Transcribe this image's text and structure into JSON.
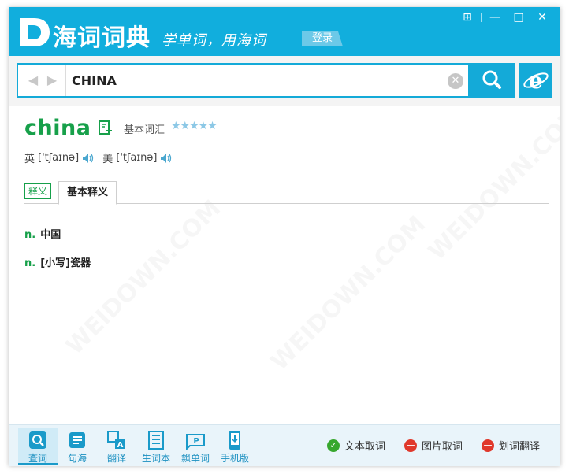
{
  "app": {
    "logo_text": "海词词典",
    "slogan": "学单词，用海词",
    "login_label": "登录"
  },
  "window_controls": {
    "menu": "⊞",
    "minimize": "—",
    "maximize": "□",
    "close": "✕"
  },
  "search": {
    "query": "CHINA"
  },
  "entry": {
    "headword": "china",
    "vocab_level": "基本词汇",
    "stars": "★★★★★",
    "uk_label": "英",
    "uk_phonetic": "['tʃaɪnə]",
    "us_label": "美",
    "us_phonetic": "['tʃaɪnə]",
    "tabs": [
      "释义",
      "基本释义"
    ],
    "definitions": [
      {
        "pos": "n.",
        "text": "中国"
      },
      {
        "pos": "n.",
        "text": "[小写]瓷器"
      }
    ]
  },
  "toolbar": {
    "tools": [
      {
        "label": "查词",
        "icon": "search-word-icon"
      },
      {
        "label": "句海",
        "icon": "sentence-icon"
      },
      {
        "label": "翻译",
        "icon": "translate-icon"
      },
      {
        "label": "生词本",
        "icon": "wordbook-icon"
      },
      {
        "label": "飘单词",
        "icon": "floating-word-icon"
      },
      {
        "label": "手机版",
        "icon": "mobile-icon"
      }
    ],
    "toggles": [
      {
        "label": "文本取词",
        "state": "on"
      },
      {
        "label": "图片取词",
        "state": "off"
      },
      {
        "label": "划词翻译",
        "state": "off"
      }
    ]
  },
  "colors": {
    "titlebar": "#11aedd",
    "accent": "#14aad8",
    "headword": "#17a04a",
    "toggle_on": "#37a72e",
    "toggle_off": "#e0382b"
  }
}
